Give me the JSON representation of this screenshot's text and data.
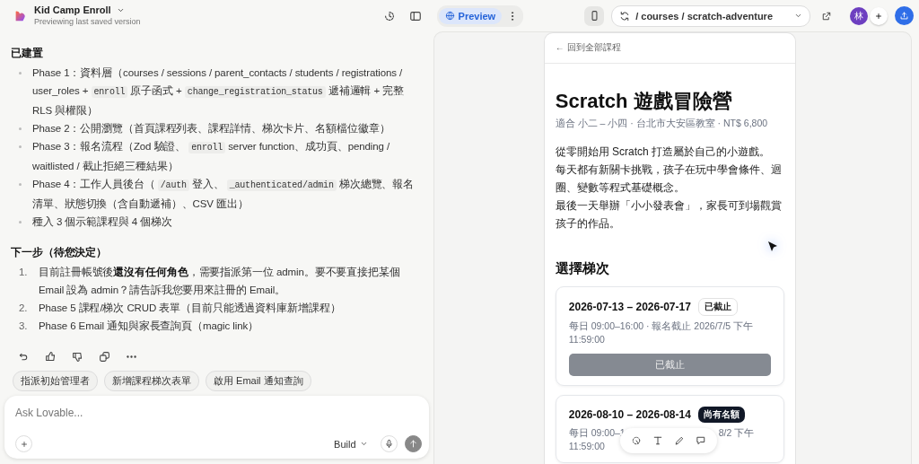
{
  "project": {
    "name": "Kid Camp Enroll",
    "subtitle": "Previewing last saved version"
  },
  "view_tabs": [
    {
      "label": "Preview",
      "selected": true
    }
  ],
  "address": {
    "path": "/ courses / scratch-adventure"
  },
  "avatar": {
    "initial": "林"
  },
  "chat": {
    "sections": [
      {
        "title": "已建置",
        "kind": "bullets",
        "items": [
          {
            "parts": [
              {
                "kind": "text",
                "text": "Phase 1：資料層（courses / sessions / parent_contacts / students / registrations / user_roles + "
              },
              {
                "kind": "code",
                "text": "enroll"
              },
              {
                "kind": "text",
                "text": " 原子函式 + "
              },
              {
                "kind": "code",
                "text": "change_registration_status"
              },
              {
                "kind": "text",
                "text": " 遞補邏輯 + 完整 RLS 與權限）"
              }
            ]
          },
          {
            "parts": [
              {
                "kind": "text",
                "text": "Phase 2：公開瀏覽（首頁課程列表、課程詳情、梯次卡片、名額檔位徽章）"
              }
            ]
          },
          {
            "parts": [
              {
                "kind": "text",
                "text": "Phase 3：報名流程（Zod 驗證、 "
              },
              {
                "kind": "code",
                "text": "enroll"
              },
              {
                "kind": "text",
                "text": " server function、成功頁、pending / waitlisted / 截止拒絕三種結果）"
              }
            ]
          },
          {
            "parts": [
              {
                "kind": "text",
                "text": "Phase 4：工作人員後台（ "
              },
              {
                "kind": "code",
                "text": "/auth"
              },
              {
                "kind": "text",
                "text": " 登入、 "
              },
              {
                "kind": "code",
                "text": "_authenticated/admin"
              },
              {
                "kind": "text",
                "text": " 梯次總覽、報名清單、狀態切換（含自動遞補）、CSV 匯出）"
              }
            ]
          },
          {
            "parts": [
              {
                "kind": "text",
                "text": "種入 3 個示範課程與 4 個梯次"
              }
            ]
          }
        ]
      },
      {
        "title": "下一步（待您決定）",
        "kind": "numbered",
        "items": [
          {
            "number": "1.",
            "parts": [
              {
                "kind": "text",
                "text": "目前註冊帳號後"
              },
              {
                "kind": "bold",
                "text": "還沒有任何角色"
              },
              {
                "kind": "text",
                "text": "，需要指派第一位 admin。要不要直接把某個 Email 設為 admin？請告訴我您要用來註冊的 Email。"
              }
            ]
          },
          {
            "number": "2.",
            "parts": [
              {
                "kind": "text",
                "text": "Phase 5 課程/梯次 CRUD 表單（目前只能透過資料庫新增課程）"
              }
            ]
          },
          {
            "number": "3.",
            "parts": [
              {
                "kind": "text",
                "text": "Phase 6 Email 通知與家長查詢頁（magic link）"
              }
            ]
          }
        ]
      }
    ]
  },
  "suggestions": [
    "指派初始管理者",
    "新增課程梯次表單",
    "啟用 Email 通知查詢"
  ],
  "composer": {
    "placeholder": "Ask Lovable...",
    "mode": "Build"
  },
  "preview": {
    "back_link": "← 回到全部課程",
    "title": "Scratch 遊戲冒險營",
    "meta": "適合 小二 – 小四 · 台北市大安區教室 · NT$ 6,800",
    "description": [
      "從零開始用 Scratch 打造屬於自己的小遊戲。",
      "每天都有新關卡挑戰，孩子在玩中學會條件、迴圈、變數等程式基礎概念。",
      "最後一天舉辦「小小發表會」，家長可到場觀賞孩子的作品。"
    ],
    "section_title": "選擇梯次",
    "sessions": [
      {
        "dates": "2026-07-13 – 2026-07-17",
        "badge": "已截止",
        "open": false,
        "schedule": [
          [
            "每日 09:00–16:00 · 報名截止 2026/7/5 下午"
          ],
          [
            "11:59:00"
          ]
        ],
        "button": "已截止",
        "disabled": true
      },
      {
        "dates": "2026-08-10 – 2026-08-14",
        "badge": "尚有名額",
        "open": true,
        "schedule": [
          [
            "每日 09:00–1",
            "8/2 下午"
          ],
          [
            "11:59:00"
          ]
        ]
      }
    ]
  }
}
